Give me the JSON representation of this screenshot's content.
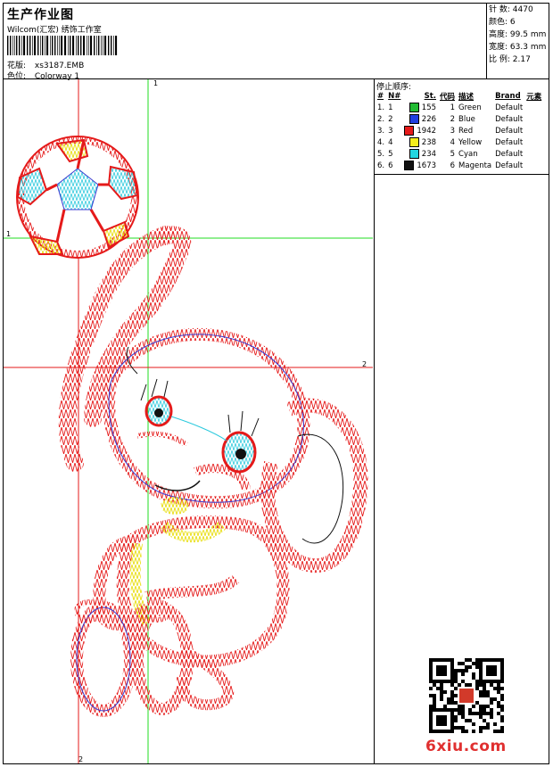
{
  "header": {
    "title": "生产作业图",
    "company": "Wilcom(汇宏) 绣饰工作室",
    "design_label": "花版:",
    "design_value": "xs3187.EMB",
    "colorway_label": "色位:",
    "colorway_value": "Colorway 1"
  },
  "stats": [
    {
      "label": "针 数:",
      "value": "4470"
    },
    {
      "label": "颜色:",
      "value": "6"
    },
    {
      "label": "高度:",
      "value": "99.5 mm"
    },
    {
      "label": "宽度:",
      "value": "63.3 mm"
    },
    {
      "label": "比 例:",
      "value": "2.17"
    }
  ],
  "stop_sequence": {
    "title": "停止顺序:",
    "headers": {
      "hash": "#",
      "n": "N#",
      "st": "St.",
      "code": "代码",
      "desc": "描述",
      "brand": "Brand",
      "elem": "元素"
    },
    "rows": [
      {
        "hash": "1.",
        "n": "1",
        "st": "155",
        "color": "#22bb33",
        "code": "1",
        "desc": "Green",
        "brand": "Default"
      },
      {
        "hash": "2.",
        "n": "2",
        "st": "226",
        "color": "#1f3fe0",
        "code": "2",
        "desc": "Blue",
        "brand": "Default"
      },
      {
        "hash": "3.",
        "n": "3",
        "st": "1942",
        "color": "#e51a1a",
        "code": "3",
        "desc": "Red",
        "brand": "Default"
      },
      {
        "hash": "4.",
        "n": "4",
        "st": "238",
        "color": "#f5ee1a",
        "code": "4",
        "desc": "Yellow",
        "brand": "Default"
      },
      {
        "hash": "5.",
        "n": "5",
        "st": "234",
        "color": "#22d6e0",
        "code": "5",
        "desc": "Cyan",
        "brand": "Default"
      },
      {
        "hash": "6.",
        "n": "6",
        "st": "1673",
        "color": "#111111",
        "code": "6",
        "desc": "Magenta",
        "brand": "Default"
      }
    ]
  },
  "axes": {
    "v1": "1",
    "h1": "1",
    "h2": "2",
    "v2": "2"
  },
  "watermark": "6xiu.com",
  "colors": {
    "red": "#e51a1a",
    "blue": "#3a3ad0",
    "cyan": "#3ad6e6",
    "yellow": "#f5ee2a",
    "green": "#22dd22",
    "black": "#111111"
  }
}
